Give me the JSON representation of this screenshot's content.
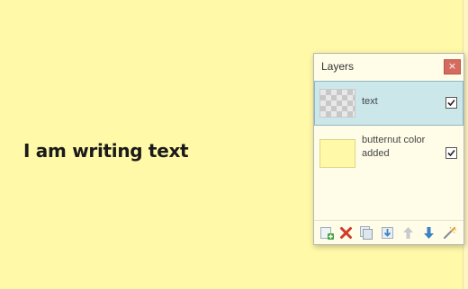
{
  "canvas": {
    "text": "I am writing text",
    "background_color": "#fff9a8"
  },
  "layers_panel": {
    "title": "Layers",
    "close_label": "×",
    "layers": [
      {
        "name": "text",
        "thumbnail": "transparent-checker",
        "visible": true,
        "selected": true
      },
      {
        "name": "butternut color added",
        "thumbnail": "yellow-fill",
        "visible": true,
        "selected": false
      }
    ],
    "toolbar_icons": [
      "add-layer-icon",
      "delete-layer-icon",
      "duplicate-layer-icon",
      "merge-layer-down-icon",
      "move-layer-up-icon",
      "move-layer-down-icon",
      "layer-properties-icon"
    ]
  },
  "colors": {
    "selected_row": "#cce7ea",
    "close_button": "#d46b5e"
  }
}
